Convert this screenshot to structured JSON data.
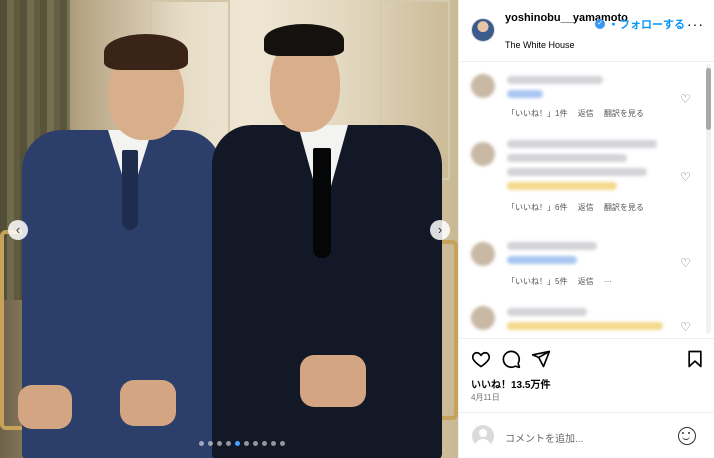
{
  "post": {
    "username": "yoshinobu__yamamoto",
    "follow_label": "・フォローする",
    "more_label": "···",
    "location": "The White House",
    "likes": "いいね！13.5万件",
    "date": "4月11日",
    "carousel": {
      "total": 10,
      "active_index": 4,
      "prev_label": "‹",
      "next_label": "›"
    }
  },
  "comments": [
    {
      "likes": "「いいね！」1件",
      "reply": "返信",
      "translate": "翻訳を見る"
    },
    {
      "likes": "「いいね！」6件",
      "reply": "返信",
      "translate": "翻訳を見る"
    },
    {
      "likes": "「いいね！」5件",
      "reply": "返信",
      "more": "···"
    },
    {
      "likes": "",
      "reply": ""
    }
  ],
  "compose": {
    "placeholder": "コメントを追加..."
  },
  "icons": {
    "like": "heart-icon",
    "comment": "comment-icon",
    "share": "send-icon",
    "save": "bookmark-icon",
    "verified": "verified-badge-icon",
    "emoji": "emoji-icon"
  },
  "colors": {
    "accent": "#0095f6",
    "verified": "#3897f0"
  }
}
